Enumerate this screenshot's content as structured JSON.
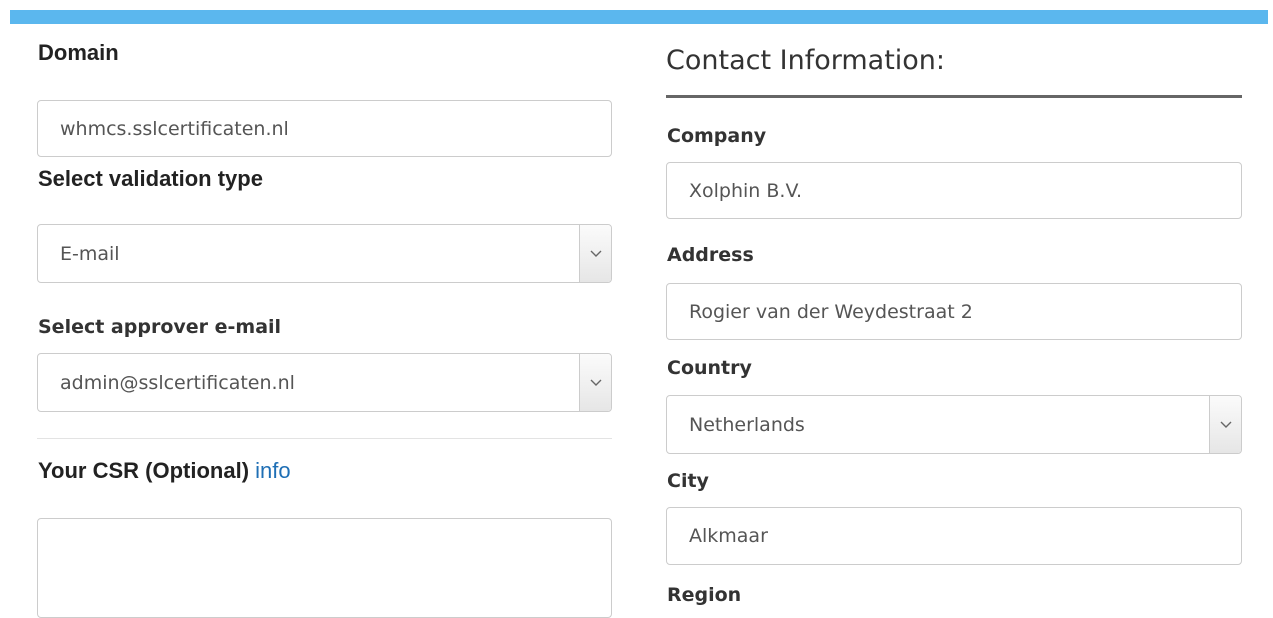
{
  "form": {
    "domain": {
      "label": "Domain",
      "value": "whmcs.sslcertificaten.nl"
    },
    "validation": {
      "label": "Select validation type",
      "value": "E-mail"
    },
    "approver": {
      "label": "Select approver e-mail",
      "value": "admin@sslcertificaten.nl"
    },
    "csr": {
      "label": "Your CSR (Optional)",
      "info_link": "info",
      "value": ""
    }
  },
  "contact": {
    "heading": "Contact Information:",
    "company": {
      "label": "Company",
      "value": "Xolphin B.V."
    },
    "address": {
      "label": "Address",
      "value": "Rogier van der Weydestraat 2"
    },
    "country": {
      "label": "Country",
      "value": "Netherlands"
    },
    "city": {
      "label": "City",
      "value": "Alkmaar"
    },
    "next_label": "Region"
  },
  "colors": {
    "accent_bar": "#5bb7ee",
    "link": "#1f6fb5",
    "border": "#cccccc"
  },
  "icons": {
    "select_caret": "chevron-down-icon"
  }
}
